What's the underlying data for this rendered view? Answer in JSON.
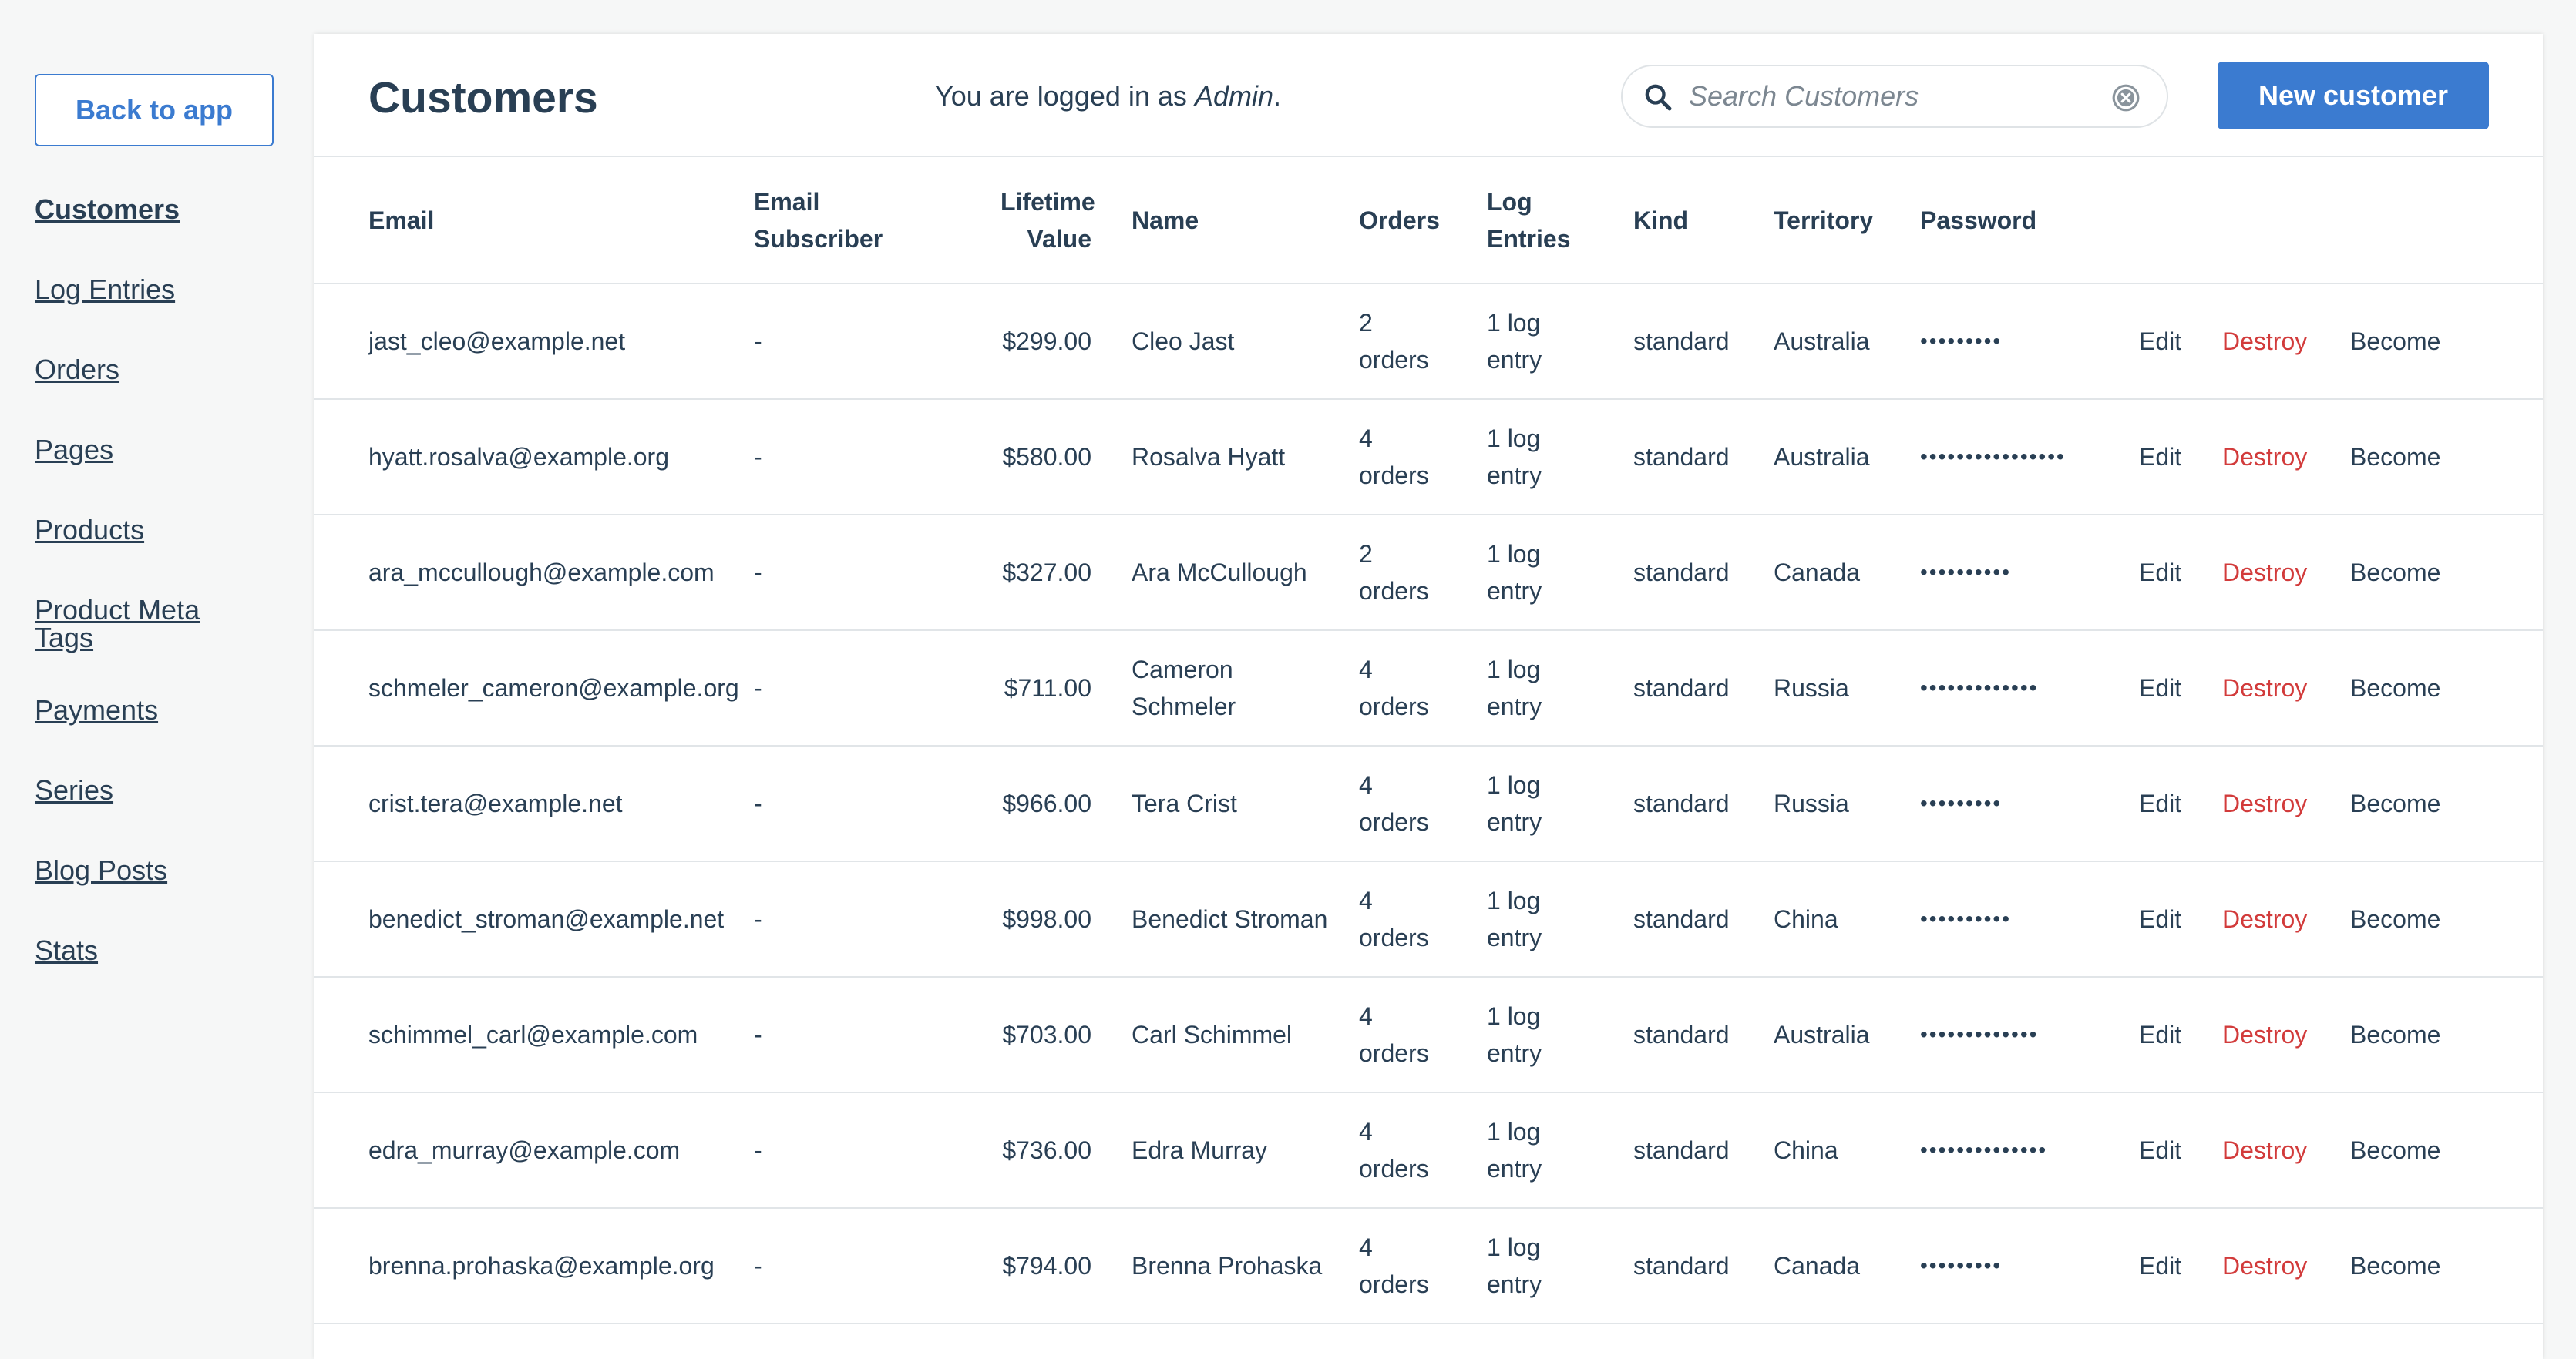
{
  "sidebar": {
    "back_label": "Back to app",
    "nav": [
      {
        "label": "Customers",
        "active": true
      },
      {
        "label": "Log Entries"
      },
      {
        "label": "Orders"
      },
      {
        "label": "Pages"
      },
      {
        "label": "Products"
      },
      {
        "label": "Product Meta Tags"
      },
      {
        "label": "Payments"
      },
      {
        "label": "Series"
      },
      {
        "label": "Blog Posts"
      },
      {
        "label": "Stats"
      }
    ]
  },
  "header": {
    "title": "Customers",
    "logged_in_prefix": "You are logged in as ",
    "logged_in_user": "Admin",
    "logged_in_suffix": ".",
    "search_placeholder": "Search Customers",
    "new_button": "New customer"
  },
  "table": {
    "columns": [
      "Email",
      "Email Subscriber",
      "Lifetime Value",
      "Name",
      "Orders",
      "Log Entries",
      "Kind",
      "Territory",
      "Password"
    ],
    "actions": {
      "edit": "Edit",
      "destroy": "Destroy",
      "become": "Become"
    },
    "rows": [
      {
        "email": "jast_cleo@example.net",
        "subscriber": "-",
        "value": "$299.00",
        "name": "Cleo Jast",
        "orders": "2 orders",
        "log": "1 log entry",
        "kind": "standard",
        "territory": "Australia",
        "password": "•••••••••"
      },
      {
        "email": "hyatt.rosalva@example.org",
        "subscriber": "-",
        "value": "$580.00",
        "name": "Rosalva Hyatt",
        "orders": "4 orders",
        "log": "1 log entry",
        "kind": "standard",
        "territory": "Australia",
        "password": "••••••••••••••••"
      },
      {
        "email": "ara_mccullough@example.com",
        "subscriber": "-",
        "value": "$327.00",
        "name": "Ara McCullough",
        "orders": "2 orders",
        "log": "1 log entry",
        "kind": "standard",
        "territory": "Canada",
        "password": "••••••••••"
      },
      {
        "email": "schmeler_cameron@example.org",
        "subscriber": "-",
        "value": "$711.00",
        "name": "Cameron Schmeler",
        "orders": "4 orders",
        "log": "1 log entry",
        "kind": "standard",
        "territory": "Russia",
        "password": "•••••••••••••"
      },
      {
        "email": "crist.tera@example.net",
        "subscriber": "-",
        "value": "$966.00",
        "name": "Tera Crist",
        "orders": "4 orders",
        "log": "1 log entry",
        "kind": "standard",
        "territory": "Russia",
        "password": "•••••••••"
      },
      {
        "email": "benedict_stroman@example.net",
        "subscriber": "-",
        "value": "$998.00",
        "name": "Benedict Stroman",
        "orders": "4 orders",
        "log": "1 log entry",
        "kind": "standard",
        "territory": "China",
        "password": "••••••••••"
      },
      {
        "email": "schimmel_carl@example.com",
        "subscriber": "-",
        "value": "$703.00",
        "name": "Carl Schimmel",
        "orders": "4 orders",
        "log": "1 log entry",
        "kind": "standard",
        "territory": "Australia",
        "password": "•••••••••••••"
      },
      {
        "email": "edra_murray@example.com",
        "subscriber": "-",
        "value": "$736.00",
        "name": "Edra Murray",
        "orders": "4 orders",
        "log": "1 log entry",
        "kind": "standard",
        "territory": "China",
        "password": "••••••••••••••"
      },
      {
        "email": "brenna.prohaska@example.org",
        "subscriber": "-",
        "value": "$794.00",
        "name": "Brenna Prohaska",
        "orders": "4 orders",
        "log": "1 log entry",
        "kind": "standard",
        "territory": "Canada",
        "password": "•••••••••"
      }
    ]
  }
}
